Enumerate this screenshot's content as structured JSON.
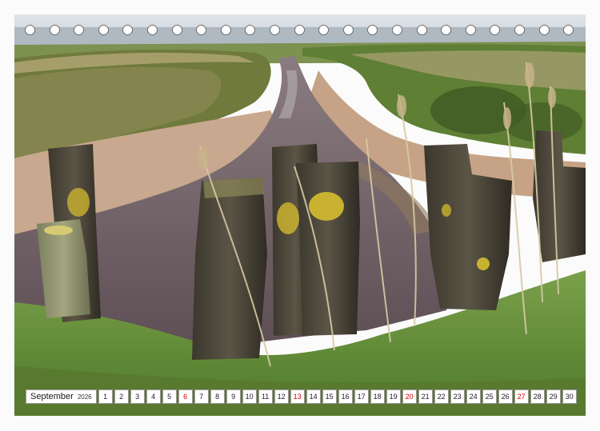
{
  "calendar": {
    "month": "September",
    "year": "2026",
    "days": [
      {
        "n": "1",
        "sun": false
      },
      {
        "n": "2",
        "sun": false
      },
      {
        "n": "3",
        "sun": false
      },
      {
        "n": "4",
        "sun": false
      },
      {
        "n": "5",
        "sun": false
      },
      {
        "n": "6",
        "sun": true
      },
      {
        "n": "7",
        "sun": false
      },
      {
        "n": "8",
        "sun": false
      },
      {
        "n": "9",
        "sun": false
      },
      {
        "n": "10",
        "sun": false
      },
      {
        "n": "11",
        "sun": false
      },
      {
        "n": "12",
        "sun": false
      },
      {
        "n": "13",
        "sun": true
      },
      {
        "n": "14",
        "sun": false
      },
      {
        "n": "15",
        "sun": false
      },
      {
        "n": "16",
        "sun": false
      },
      {
        "n": "17",
        "sun": false
      },
      {
        "n": "18",
        "sun": false
      },
      {
        "n": "19",
        "sun": false
      },
      {
        "n": "20",
        "sun": true
      },
      {
        "n": "21",
        "sun": false
      },
      {
        "n": "22",
        "sun": false
      },
      {
        "n": "23",
        "sun": false
      },
      {
        "n": "24",
        "sun": false
      },
      {
        "n": "25",
        "sun": false
      },
      {
        "n": "26",
        "sun": false
      },
      {
        "n": "27",
        "sun": true
      },
      {
        "n": "28",
        "sun": false
      },
      {
        "n": "29",
        "sun": false
      },
      {
        "n": "30",
        "sun": false
      }
    ]
  },
  "colors": {
    "sky": "#d7dde3",
    "sea": "#a9b6bf",
    "grass": "#6b8f3a",
    "sand": "#c7a58b",
    "water": "#6e5a5f",
    "wood": "#4a4438",
    "lichen": "#c9b230",
    "sunday": "#d40000"
  }
}
